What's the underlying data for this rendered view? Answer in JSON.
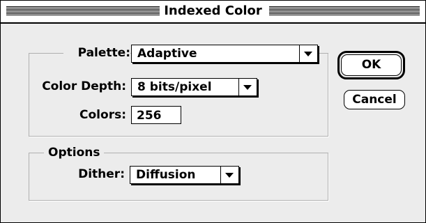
{
  "window": {
    "title": "Indexed Color"
  },
  "palette": {
    "label": "Palette:",
    "value": "Adaptive"
  },
  "color_depth": {
    "label": "Color Depth:",
    "value": "8 bits/pixel"
  },
  "colors": {
    "label": "Colors:",
    "value": "256"
  },
  "options": {
    "legend": "Options",
    "dither_label": "Dither:",
    "dither_value": "Diffusion"
  },
  "buttons": {
    "ok_label": "OK",
    "cancel_label": "Cancel"
  },
  "icons": {
    "popup_arrow": "triangle-down-icon"
  }
}
